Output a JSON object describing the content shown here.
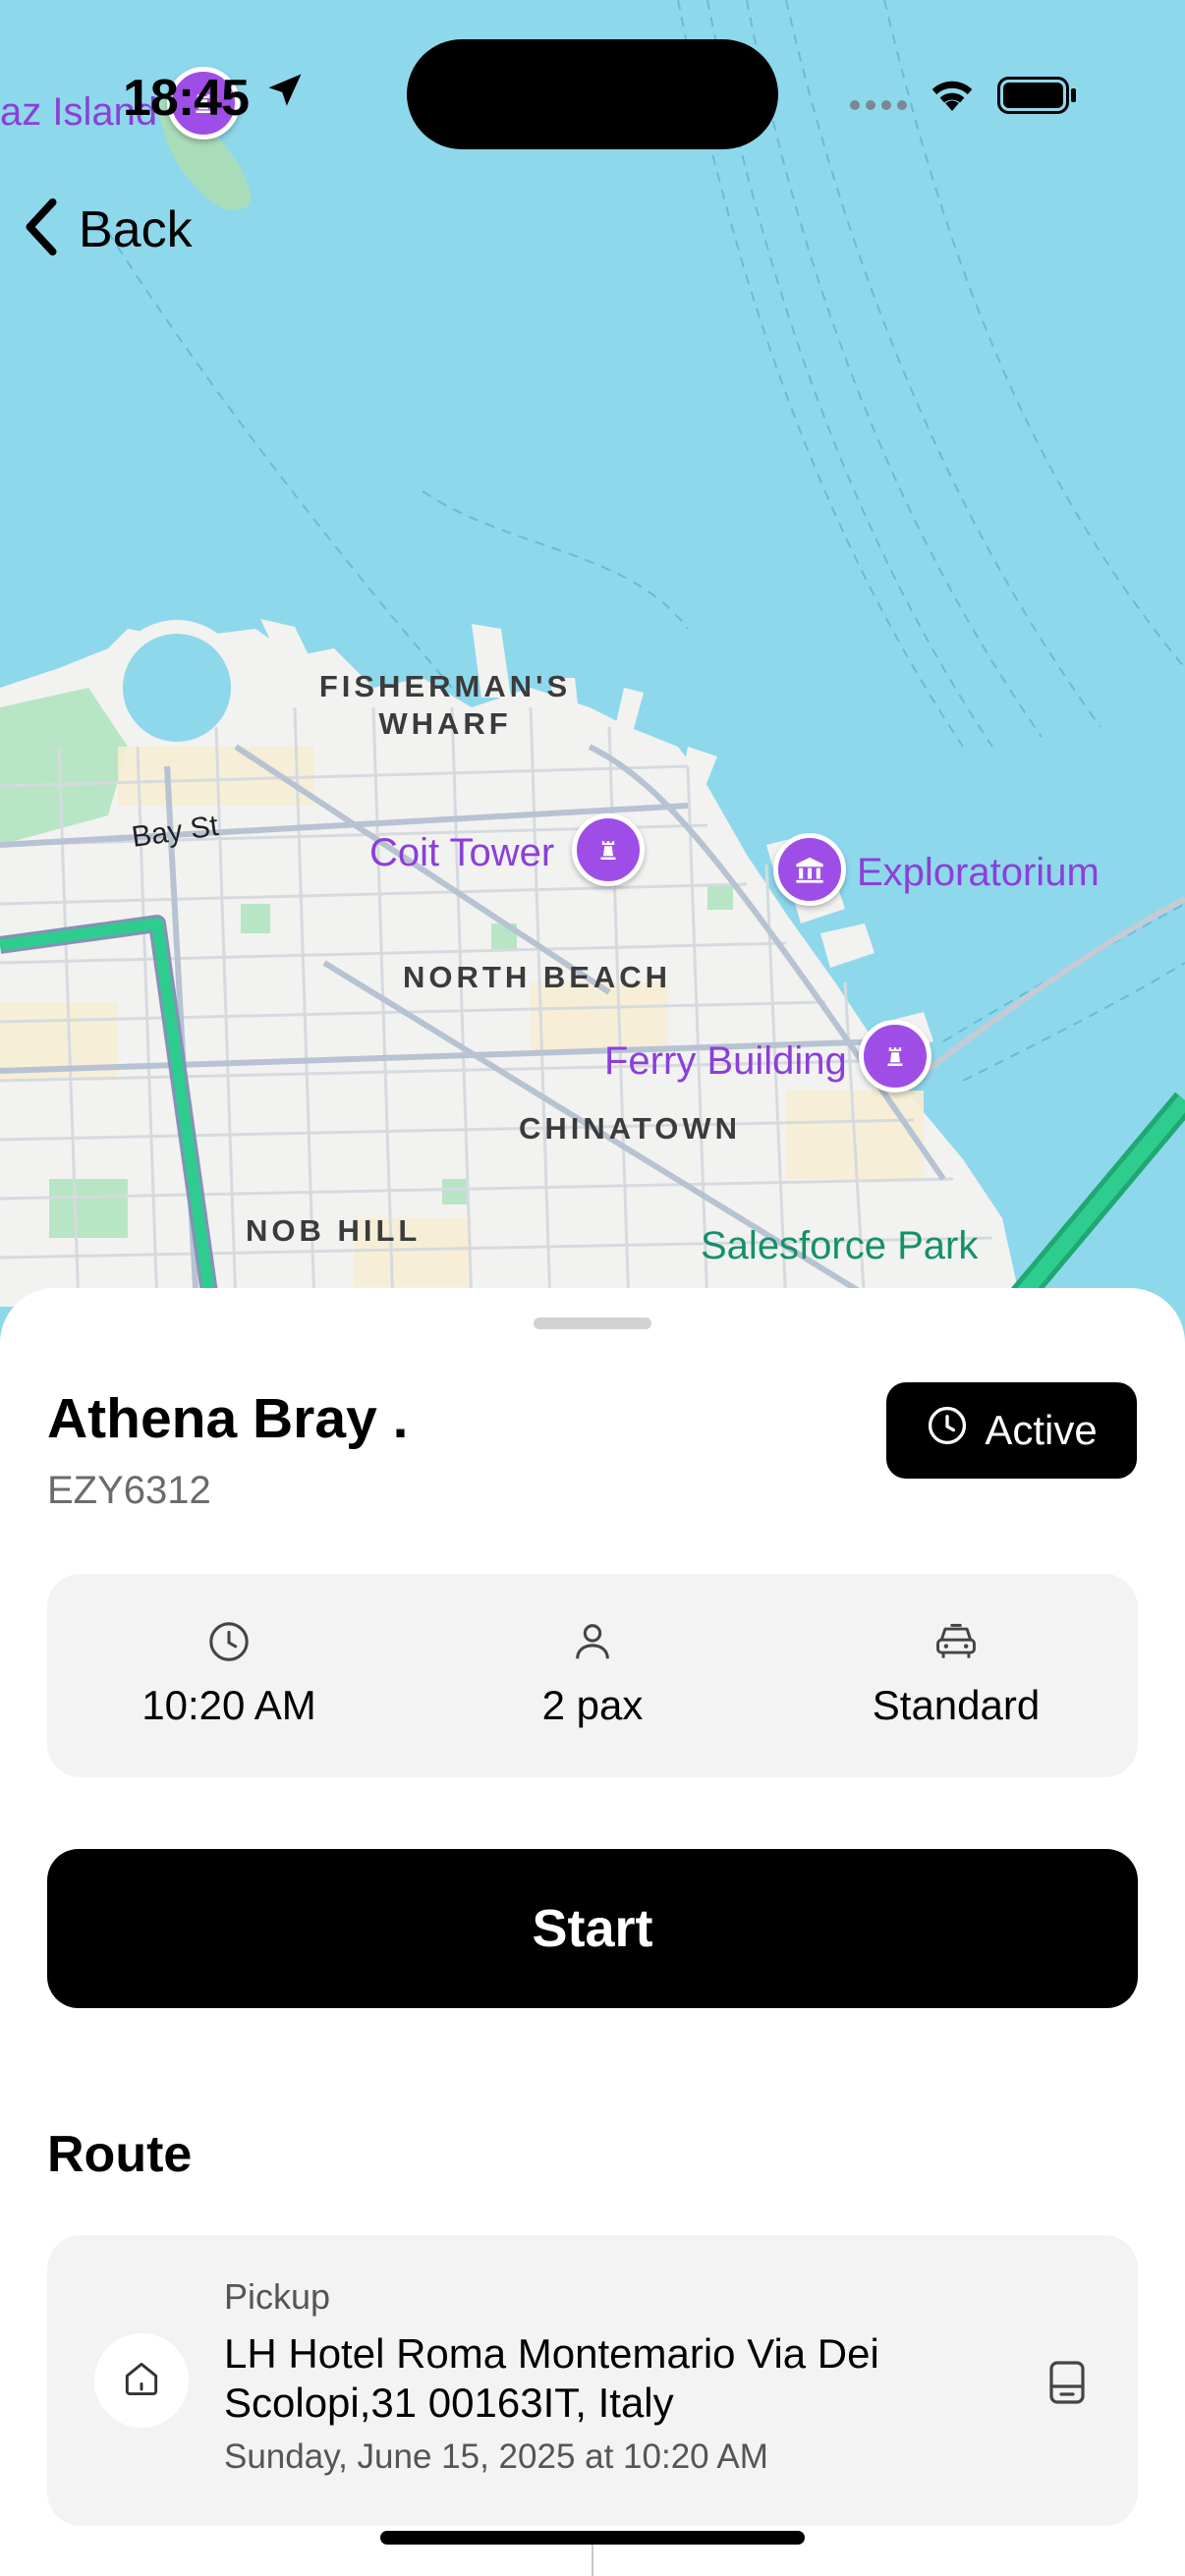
{
  "status_bar": {
    "time": "18:45"
  },
  "nav": {
    "back_label": "Back"
  },
  "map": {
    "labels": {
      "alcatraz": "az Island",
      "fishermans_wharf_1": "FISHERMAN'S",
      "fishermans_wharf_2": "WHARF",
      "bay_st": "Bay St",
      "coit_tower": "Coit Tower",
      "exploratorium": "Exploratorium",
      "north_beach": "NORTH BEACH",
      "ferry_building": "Ferry Building",
      "chinatown": "CHINATOWN",
      "nob_hill": "NOB HILL",
      "salesforce_park": "Salesforce Park"
    },
    "colors": {
      "water": "#8ED8EC",
      "land": "#F2F2F0",
      "route": "#2ECC8F",
      "poi": "#9E4EE6"
    }
  },
  "ride": {
    "passenger_name": "Athena Bray .",
    "booking_code": "EZY6312",
    "status": "Active",
    "pickup_time": "10:20 AM",
    "passengers": "2 pax",
    "vehicle_class": "Standard",
    "start_label": "Start"
  },
  "route": {
    "heading": "Route",
    "stops": [
      {
        "type": "Pickup",
        "address": "LH Hotel Roma Montemario Via Dei Scolopi,31   00163IT, Italy",
        "datetime": "Sunday, June 15, 2025 at 10:20 AM",
        "icon": "home-icon"
      }
    ]
  }
}
